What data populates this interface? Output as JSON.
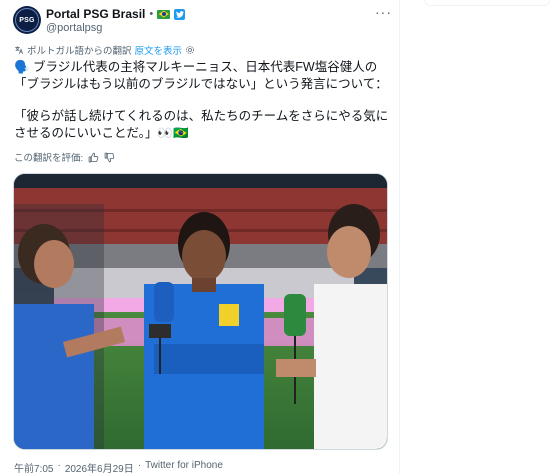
{
  "account": {
    "display_name": "Portal PSG Brasil",
    "separator": "•",
    "handle": "@portalpsg",
    "avatar_text": "PSG",
    "flag_icon": "brazil-flag",
    "badge_icon": "twitter-badge"
  },
  "menu": {
    "more_label": "···"
  },
  "translation_bar": {
    "label": "ポルトガル語からの翻訳",
    "show_original": "原文を表示",
    "gear_icon": "gear-icon"
  },
  "tweet": {
    "line1": "🗣️ ブラジル代表の主将マルキーニョス、日本代表FW塩谷健人の「ブラジルはもう以前のブラジルではない」という発言について：",
    "line2": "「彼らが話し続けてくれるのは、私たちのチームをさらにやる気にさせるのにいいことだ。」👀🇧🇷"
  },
  "rating": {
    "label": "この翻訳を評価:",
    "thumbs_up_icon": "thumbs-up-icon",
    "thumbs_down_icon": "thumbs-down-icon"
  },
  "media": {
    "alt": "",
    "colors": {
      "sky": "#3b4d60",
      "stand": "#9c3a36",
      "pitch": "#3f7a3a",
      "lights": "#f3a9e6"
    }
  },
  "footer": {
    "time": "午前7:05",
    "dot1": "·",
    "date": "2026年6月29日",
    "dot2": "·",
    "source": "Twitter for iPhone"
  },
  "colors": {
    "accent": "#1d9bf0",
    "text": "#0f1419",
    "muted": "#536471"
  }
}
